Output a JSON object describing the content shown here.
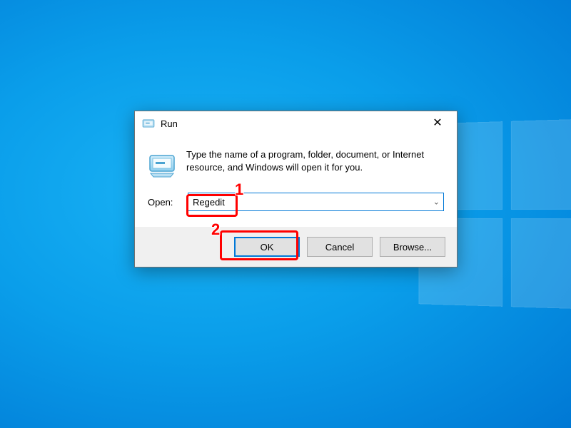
{
  "dialog": {
    "title": "Run",
    "description": "Type the name of a program, folder, document, or Internet resource, and Windows will open it for you.",
    "open_label": "Open:",
    "open_value": "Regedit",
    "buttons": {
      "ok": "OK",
      "cancel": "Cancel",
      "browse": "Browse..."
    },
    "close_glyph": "✕"
  },
  "annotations": {
    "one": "1",
    "two": "2"
  },
  "icons": {
    "titlebar": "run-icon",
    "body": "run-icon",
    "close": "close-icon",
    "chevron": "chevron-down-icon"
  }
}
